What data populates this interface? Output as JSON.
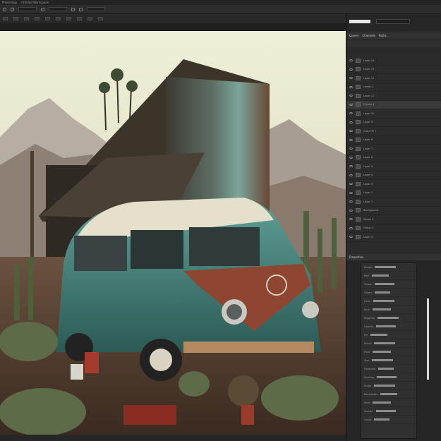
{
  "menubar": {
    "items": [
      "Photoshop",
      "Untitled Workspace"
    ]
  },
  "options": {
    "values": [
      "",
      "",
      "",
      "",
      ""
    ]
  },
  "layers_panel": {
    "tabs": [
      "Layers",
      "Channels",
      "Paths"
    ]
  },
  "layers": [
    {
      "name": "Layer 14"
    },
    {
      "name": "Layer 13"
    },
    {
      "name": "Layer 12"
    },
    {
      "name": "Levels 1"
    },
    {
      "name": "Layer 11"
    },
    {
      "name": "Curves 1"
    },
    {
      "name": "Layer 10"
    },
    {
      "name": "Layer 9"
    },
    {
      "name": "Color Fill 1"
    },
    {
      "name": "Layer 8"
    },
    {
      "name": "Layer 7"
    },
    {
      "name": "Layer 6"
    },
    {
      "name": "Layer 5"
    },
    {
      "name": "Layer 4"
    },
    {
      "name": "Layer 3"
    },
    {
      "name": "Layer 2"
    },
    {
      "name": "Layer 1"
    },
    {
      "name": "Background"
    },
    {
      "name": "Shape 1"
    },
    {
      "name": "Group 1"
    },
    {
      "name": "Layer 0"
    }
  ],
  "properties": {
    "title": "Properties",
    "rows": [
      "Preset",
      "Red",
      "Yellow",
      "Green",
      "Cyan",
      "Blue",
      "Magenta",
      "Opacity",
      "Fill",
      "Blend",
      "Flow",
      "Size",
      "Hardness",
      "Spacing",
      "Angle",
      "Roundness",
      "Jitter",
      "Scatter",
      "Count"
    ]
  },
  "colors": {
    "panel": "#2b2b2b",
    "canvas_sky": "#e8e3cc"
  }
}
